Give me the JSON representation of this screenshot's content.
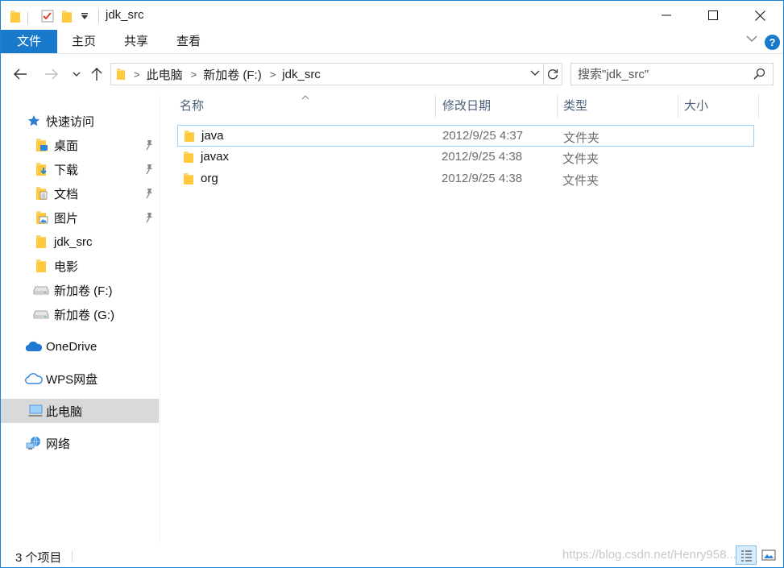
{
  "window": {
    "title": "jdk_src"
  },
  "ribbon": {
    "tabs": [
      {
        "label": "文件"
      },
      {
        "label": "主页"
      },
      {
        "label": "共享"
      },
      {
        "label": "查看"
      }
    ],
    "help_label": "?"
  },
  "address": {
    "breadcrumbs": [
      "此电脑",
      "新加卷 (F:)",
      "jdk_src"
    ]
  },
  "search": {
    "placeholder": "搜索\"jdk_src\""
  },
  "nav": {
    "items": [
      {
        "label": "快速访问",
        "icon": "star-icon"
      },
      {
        "label": "桌面",
        "icon": "desktop-folder-icon",
        "pinned": true
      },
      {
        "label": "下载",
        "icon": "download-folder-icon",
        "pinned": true
      },
      {
        "label": "文档",
        "icon": "documents-folder-icon",
        "pinned": true
      },
      {
        "label": "图片",
        "icon": "pictures-folder-icon",
        "pinned": true
      },
      {
        "label": "jdk_src",
        "icon": "folder-icon"
      },
      {
        "label": "电影",
        "icon": "folder-icon"
      },
      {
        "label": "新加卷 (F:)",
        "icon": "drive-icon"
      },
      {
        "label": "新加卷 (G:)",
        "icon": "drive-icon"
      },
      {
        "label": "OneDrive",
        "icon": "onedrive-cloud-icon"
      },
      {
        "label": "WPS网盘",
        "icon": "wps-cloud-icon"
      },
      {
        "label": "此电脑",
        "icon": "computer-icon",
        "selected": true
      },
      {
        "label": "网络",
        "icon": "network-icon"
      }
    ]
  },
  "columns": {
    "name": "名称",
    "modified": "修改日期",
    "type": "类型",
    "size": "大小"
  },
  "files": [
    {
      "name": "java",
      "modified": "2012/9/25 4:37",
      "type": "文件夹"
    },
    {
      "name": "javax",
      "modified": "2012/9/25 4:38",
      "type": "文件夹"
    },
    {
      "name": "org",
      "modified": "2012/9/25 4:38",
      "type": "文件夹"
    }
  ],
  "status": {
    "item_count": "3 个项目",
    "watermark": "https://blog.csdn.net/Henry958..."
  },
  "colors": {
    "accent": "#1979ca",
    "selection": "#d9d9d9",
    "folder": "#ffc83d",
    "column_header_text": "#4c607a"
  }
}
